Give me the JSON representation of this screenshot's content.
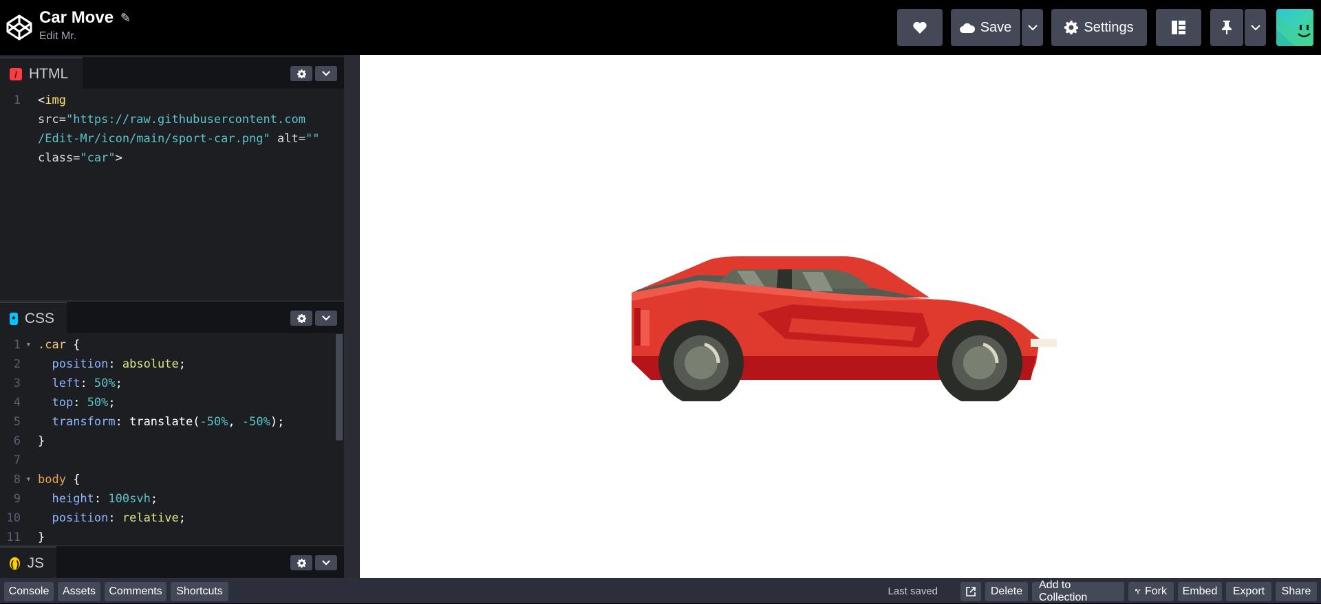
{
  "header": {
    "title": "Car Move",
    "subtitle": "Edit Mr.",
    "save_label": "Save",
    "settings_label": "Settings"
  },
  "panes": {
    "html_label": "HTML",
    "css_label": "CSS",
    "js_label": "JS"
  },
  "html_code": {
    "line1_num": "1",
    "tag_open": "<",
    "tag_name": "img",
    "src_attr": "src=",
    "src_val_1": "\"https://raw.githubusercontent.com",
    "src_val_2": "/Edit-Mr/icon/main/sport-car.png\"",
    "alt_attr": " alt=",
    "alt_val": "\"\"",
    "class_attr": "class=",
    "class_val": "\"car\"",
    "tag_close": ">"
  },
  "css_code": {
    "lines": [
      {
        "num": "1",
        "fold": true
      },
      {
        "num": "2"
      },
      {
        "num": "3"
      },
      {
        "num": "4"
      },
      {
        "num": "5"
      },
      {
        "num": "6"
      },
      {
        "num": "7"
      },
      {
        "num": "8",
        "fold": true
      },
      {
        "num": "9"
      },
      {
        "num": "10"
      },
      {
        "num": "11"
      }
    ],
    "sel_car": ".car",
    "sel_body": "body",
    "brace_open": " {",
    "brace_close": "}",
    "p_position": "position",
    "v_absolute": "absolute",
    "p_left": "left",
    "v_50": "50%",
    "p_top": "top",
    "p_transform": "transform",
    "v_translate_fn": "translate(",
    "v_neg50": "-50%",
    "comma": ", ",
    "v_close": ");",
    "p_height": "height",
    "v_100svh": "100svh",
    "v_relative": "relative",
    "colon": ": ",
    "semi": ";"
  },
  "footer": {
    "console": "Console",
    "assets": "Assets",
    "comments": "Comments",
    "shortcuts": "Shortcuts",
    "last_saved": "Last saved",
    "delete": "Delete",
    "add_to_collection": "Add to Collection",
    "fork": "Fork",
    "embed": "Embed",
    "export": "Export",
    "share": "Share"
  },
  "colors": {
    "html_icon": "#ff3c41",
    "css_icon": "#0ebeff",
    "js_icon": "#fcd000",
    "car_body": "#e03a2e"
  },
  "icons": [
    "codepen-logo-icon",
    "pencil-icon",
    "heart-icon",
    "cloud-icon",
    "chevron-down-icon",
    "gear-icon",
    "layout-icon",
    "pin-icon",
    "external-link-icon",
    "fork-icon"
  ]
}
